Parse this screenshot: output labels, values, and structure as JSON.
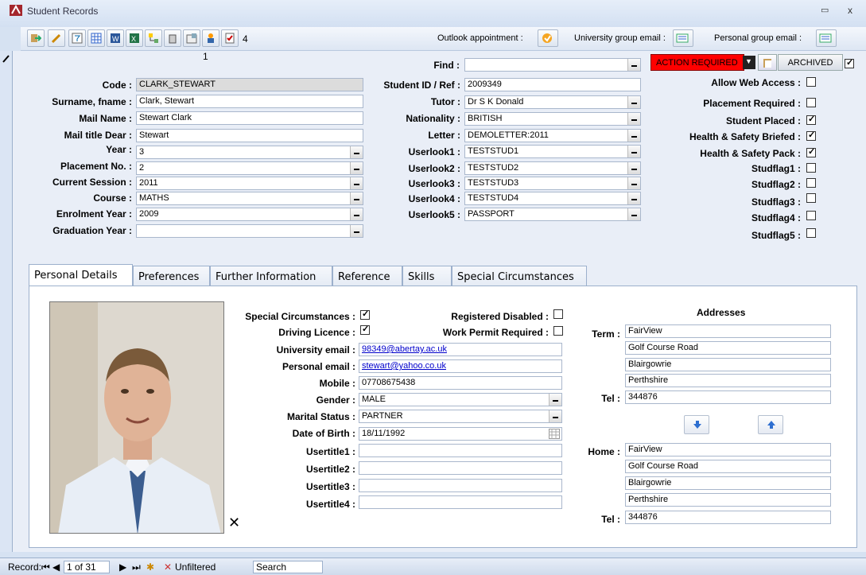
{
  "window": {
    "title": "Student Records",
    "min": "▭",
    "close": "x"
  },
  "toolbar": {
    "count": "4",
    "outlook_label": "Outlook appointment :",
    "uni_email_label": "University group email :",
    "personal_email_label": "Personal group email :"
  },
  "record_number": "1",
  "find": {
    "label": "Find :",
    "value": ""
  },
  "action": {
    "label": "ACTION REQUIRED",
    "archived": "ARCHIVED",
    "color": "#ff0000"
  },
  "left_fields": [
    {
      "label": "Code :",
      "value": "CLARK_STEWART"
    },
    {
      "label": "Surname, fname :",
      "value": "Clark, Stewart"
    },
    {
      "label": "Mail Name :",
      "value": "Stewart Clark"
    },
    {
      "label": "Mail title Dear :",
      "value": "Stewart"
    },
    {
      "label": "Year :",
      "value": "3"
    },
    {
      "label": "Placement No. :",
      "value": "2"
    },
    {
      "label": "Current Session :",
      "value": "2011"
    },
    {
      "label": "Course :",
      "value": "MATHS"
    },
    {
      "label": "Enrolment Year :",
      "value": "2009"
    },
    {
      "label": "Graduation Year :",
      "value": ""
    }
  ],
  "mid_fields": [
    {
      "label": "Student ID / Ref :",
      "value": "2009349"
    },
    {
      "label": "Tutor :",
      "value": "Dr S K Donald"
    },
    {
      "label": "Nationality :",
      "value": "BRITISH"
    },
    {
      "label": "Letter :",
      "value": "DEMOLETTER:2011"
    },
    {
      "label": "Userlook1 :",
      "value": "TESTSTUD1"
    },
    {
      "label": "Userlook2 :",
      "value": "TESTSTUD2"
    },
    {
      "label": "Userlook3 :",
      "value": "TESTSTUD3"
    },
    {
      "label": "Userlook4 :",
      "value": "TESTSTUD4"
    },
    {
      "label": "Userlook5 :",
      "value": "PASSPORT"
    }
  ],
  "flags": [
    {
      "label": "Allow Web Access :",
      "checked": false
    },
    {
      "label": "Placement Required :",
      "checked": false
    },
    {
      "label": "Student Placed :",
      "checked": true
    },
    {
      "label": "Health & Safety  Briefed :",
      "checked": true
    },
    {
      "label": "Health & Safety Pack :",
      "checked": true
    },
    {
      "label": "Studflag1 :",
      "checked": false
    },
    {
      "label": "Studflag2 :",
      "checked": false
    },
    {
      "label": "Studflag3 :",
      "checked": false
    },
    {
      "label": "Studflag4 :",
      "checked": false
    },
    {
      "label": "Studflag5 :",
      "checked": false
    }
  ],
  "tabs": [
    "Personal Details",
    "Preferences",
    "Further Information",
    "Reference",
    "Skills",
    "Special Circumstances"
  ],
  "personal": {
    "special_circ": "Special Circumstances :",
    "driving": "Driving Licence :",
    "reg_disabled": "Registered Disabled :",
    "work_permit": "Work Permit Required :",
    "uni_email_label": "University email :",
    "uni_email": "98349@abertay.ac.uk",
    "personal_email_label": "Personal email :",
    "personal_email": "stewart@yahoo.co.uk",
    "mobile_label": "Mobile :",
    "mobile": "07708675438",
    "gender_label": "Gender :",
    "gender": "MALE",
    "marital_label": "Marital Status :",
    "marital": "PARTNER",
    "dob_label": "Date of Birth :",
    "dob": "18/11/1992",
    "usertitle1": "Usertitle1 :",
    "usertitle2": "Usertitle2 :",
    "usertitle3": "Usertitle3 :",
    "usertitle4": "Usertitle4 :"
  },
  "addresses": {
    "title": "Addresses",
    "term_label": "Term :",
    "term": [
      "FairView",
      "Golf Course Road",
      "Blairgowrie",
      "Perthshire"
    ],
    "tel_label": "Tel :",
    "term_tel": "344876",
    "home_label": "Home :",
    "home": [
      "FairView",
      "Golf Course Road",
      "Blairgowrie",
      "Perthshire"
    ],
    "home_tel": "344876"
  },
  "statusbar": {
    "record": "Record:",
    "position": "1 of 31",
    "filter": "Unfiltered",
    "search": "Search"
  }
}
